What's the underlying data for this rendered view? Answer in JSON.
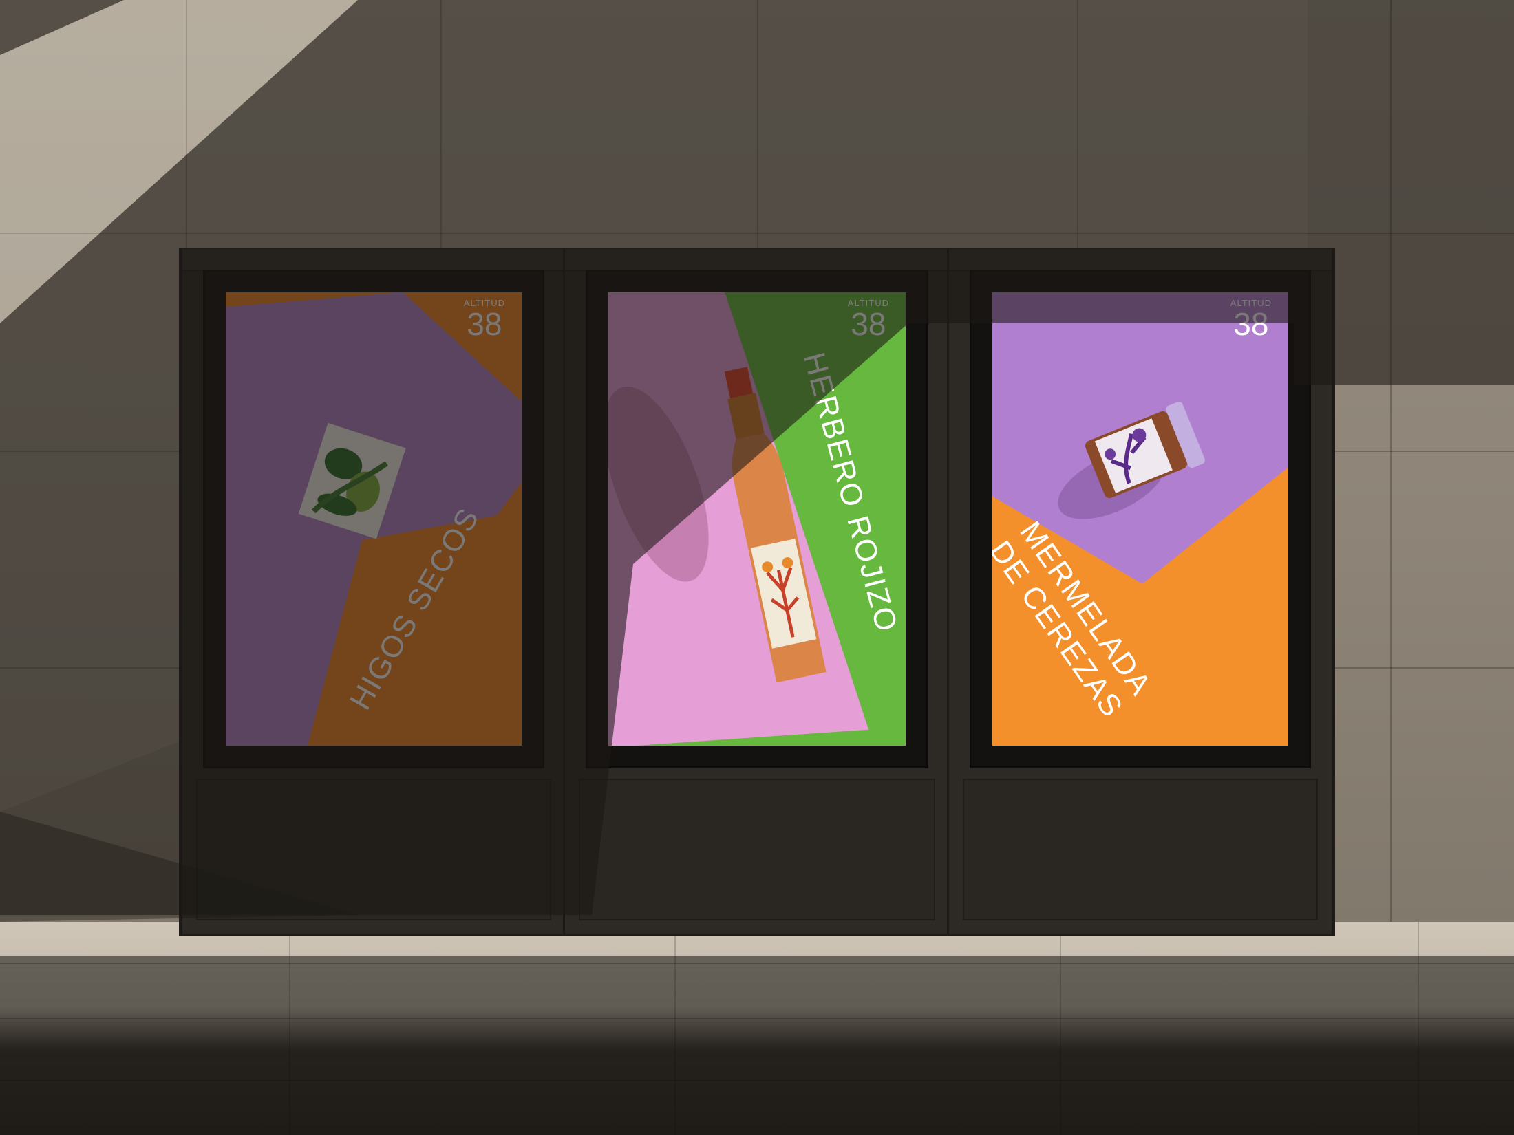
{
  "posters": [
    {
      "brand_word": "ALTITUD",
      "brand_number": "38",
      "title_lines": [
        "HIGOS SECOS"
      ],
      "colors": {
        "primary": "#ef8124",
        "secondary": "#b481c9"
      },
      "product": "fig-box-icon"
    },
    {
      "brand_word": "ALTITUD",
      "brand_number": "38",
      "title_lines": [
        "HERBERO ROJIZO"
      ],
      "colors": {
        "primary": "#66b83f",
        "secondary": "#e59ed6"
      },
      "product": "bottle-icon"
    },
    {
      "brand_word": "ALTITUD",
      "brand_number": "38",
      "title_lines": [
        "MERMELADA",
        "DE CEREZAS"
      ],
      "colors": {
        "primary": "#f3902c",
        "secondary": "#b17fd0"
      },
      "product": "jam-jar-icon"
    }
  ]
}
